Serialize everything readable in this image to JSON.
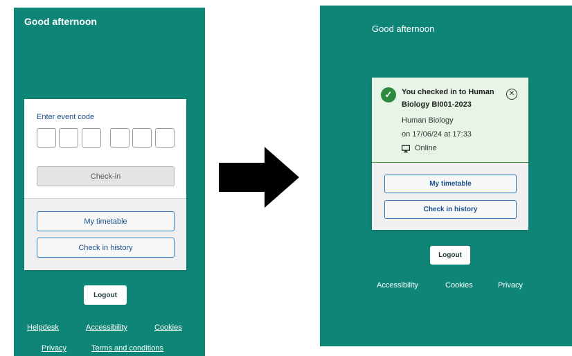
{
  "left": {
    "greeting": "Good afternoon",
    "event_code_label": "Enter event code",
    "checkin_label": "Check-in",
    "my_timetable_label": "My timetable",
    "check_in_history_label": "Check in history",
    "logout_label": "Logout",
    "footer_links": [
      "Helpdesk",
      "Accessibility",
      "Cookies",
      "Privacy",
      "Terms and conditions"
    ]
  },
  "right": {
    "greeting": "Good afternoon",
    "notice_title": "You checked in to Human Biology BI001-2023",
    "notice_course": "Human Biology",
    "notice_time": "on 17/06/24 at 17:33",
    "notice_mode": "Online",
    "my_timetable_label": "My timetable",
    "check_in_history_label": "Check in history",
    "logout_label": "Logout",
    "footer_links": [
      "Accessibility",
      "Cookies",
      "Privacy"
    ]
  },
  "colors": {
    "panel": "#0f8577",
    "link_blue": "#1a4f8c",
    "success_green": "#2e8b3e"
  },
  "icons": {
    "arrow": "right-arrow-icon",
    "success": "check-circle-icon",
    "close": "close-circle-icon",
    "mode": "monitor-icon"
  }
}
